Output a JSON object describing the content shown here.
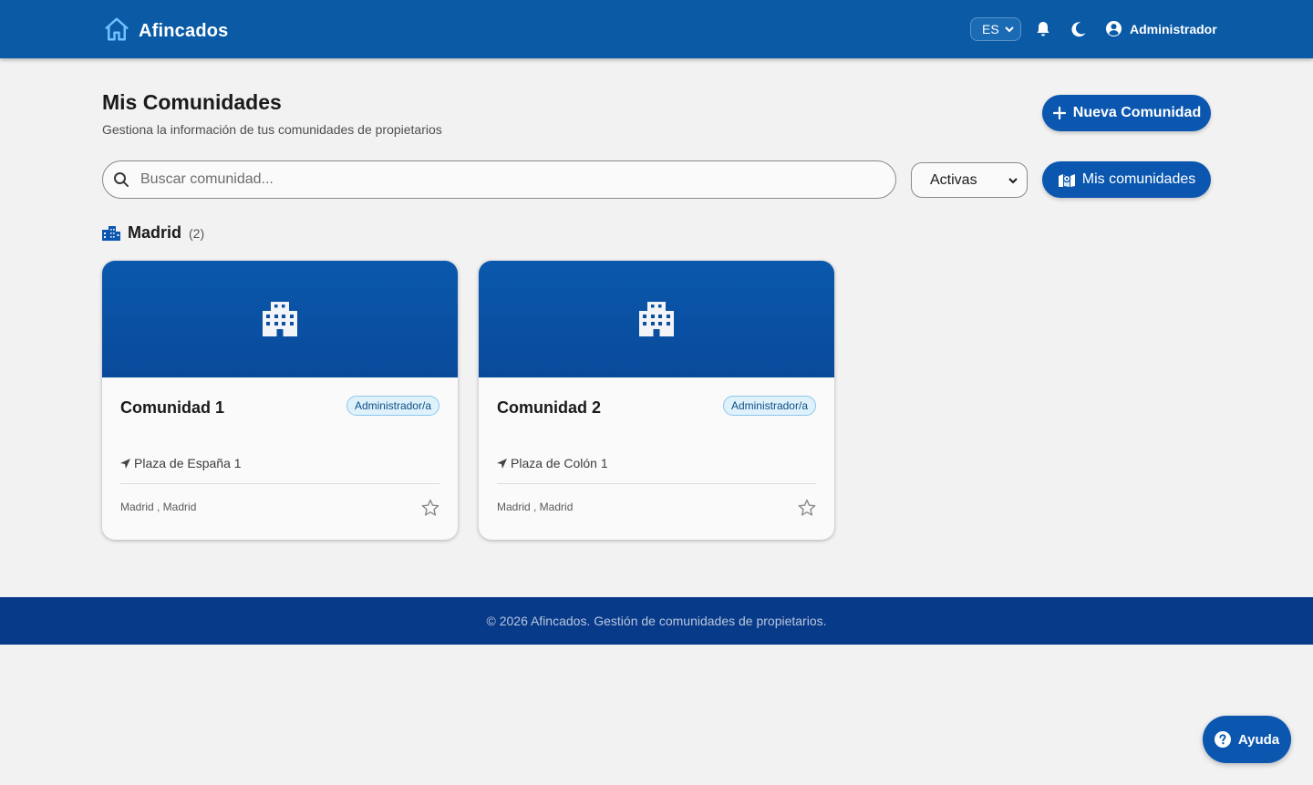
{
  "header": {
    "brand": "Afincados",
    "language": "ES",
    "user_name": "Administrador",
    "icons": [
      "home-icon",
      "bell-icon",
      "moon-icon",
      "user-circle-icon"
    ]
  },
  "page": {
    "title": "Mis Comunidades",
    "subtitle": "Gestiona la información de tus comunidades de propietarios",
    "new_button": "Nueva Comunidad",
    "mine_button": "Mis comunidades"
  },
  "search": {
    "placeholder": "Buscar comunidad..."
  },
  "filter": {
    "selected": "Activas"
  },
  "section": {
    "name": "Madrid",
    "count": "(2)"
  },
  "cards": [
    {
      "title": "Comunidad 1",
      "role": "Administrador/a",
      "address": "Plaza de España 1",
      "city": "Madrid , Madrid"
    },
    {
      "title": "Comunidad 2",
      "role": "Administrador/a",
      "address": "Plaza de Colón 1",
      "city": "Madrid , Madrid"
    }
  ],
  "footer": {
    "text": "© 2026 Afincados. Gestión de comunidades de propietarios."
  },
  "help": {
    "label": "Ayuda"
  },
  "colors": {
    "primary": "#0b57b0",
    "header": "#0a5aa6",
    "footer": "#083a8a",
    "background": "#f2f2f2",
    "badge_bg": "#dff1fb",
    "badge_text": "#0b4f86"
  }
}
